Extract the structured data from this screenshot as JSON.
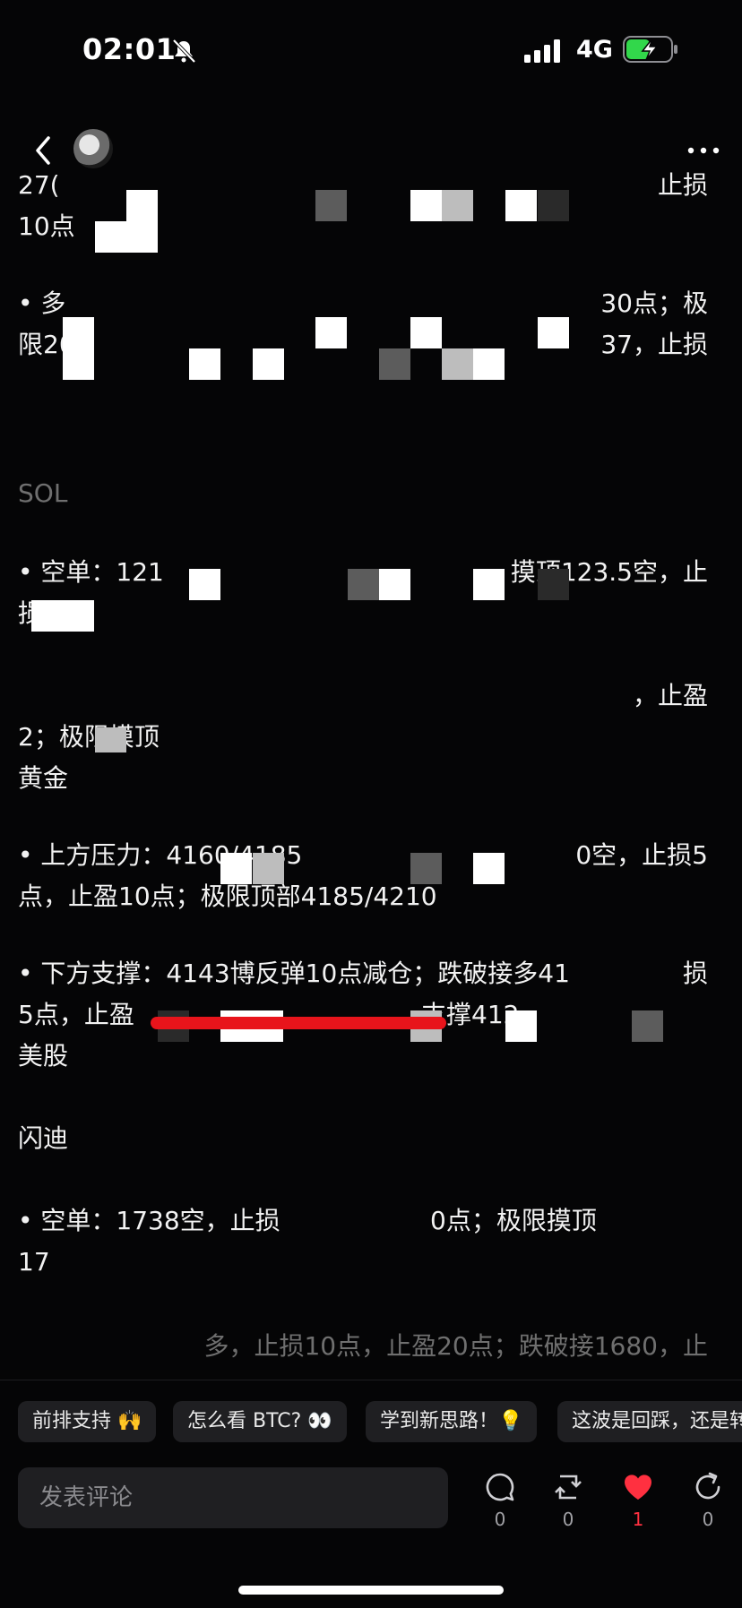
{
  "status": {
    "time": "02:01",
    "network": "4G"
  },
  "article": {
    "lines": [
      {
        "t": "27(",
        "top": 0
      },
      {
        "t": "止损",
        "right": true
      },
      {
        "t": "10点"
      },
      {
        "t": "• 多"
      },
      {
        "t": "30点；极",
        "right": true
      },
      {
        "t": "限20"
      },
      {
        "t": "37，止损",
        "right": true
      },
      {
        "t": "SOL"
      },
      {
        "t": "• 空单：121"
      },
      {
        "t": "摸顶123.5空，止",
        "right": true
      },
      {
        "t": "损0"
      },
      {
        "t": "，止盈",
        "right": true
      },
      {
        "t": "2；极限摸顶"
      },
      {
        "t": "黄金"
      },
      {
        "t": "• 上方压力：4160/4185"
      },
      {
        "t": "0空，止损5",
        "right": true
      },
      {
        "t": "点，止盈10点；极限顶部4185/4210"
      },
      {
        "t": "• 下方支撑：4143博反弹10点减仓；跌破接多41"
      },
      {
        "t": "损",
        "right": true
      },
      {
        "t": "5点，止盈"
      },
      {
        "t": "支撑412"
      },
      {
        "t": "美股"
      },
      {
        "t": "闪迪"
      },
      {
        "t": "• 空单：1738空，止损"
      },
      {
        "t": "0点；极限摸顶"
      },
      {
        "t": "17"
      },
      {
        "t": "多，止损10点，止盈20点；跌破接1680，止"
      }
    ]
  },
  "chips": [
    "前排支持 🙌",
    "怎么看 BTC? 👀",
    "学到新思路！💡",
    "这波是回踩，还是转"
  ],
  "comment_placeholder": "发表评论",
  "actions": {
    "comment_count": "0",
    "repost_count": "0",
    "like_count": "1",
    "share_count": "0"
  },
  "colors": {
    "like": "#ff3040",
    "highlight_line": "#e8141b",
    "battery": "#32d74b"
  }
}
